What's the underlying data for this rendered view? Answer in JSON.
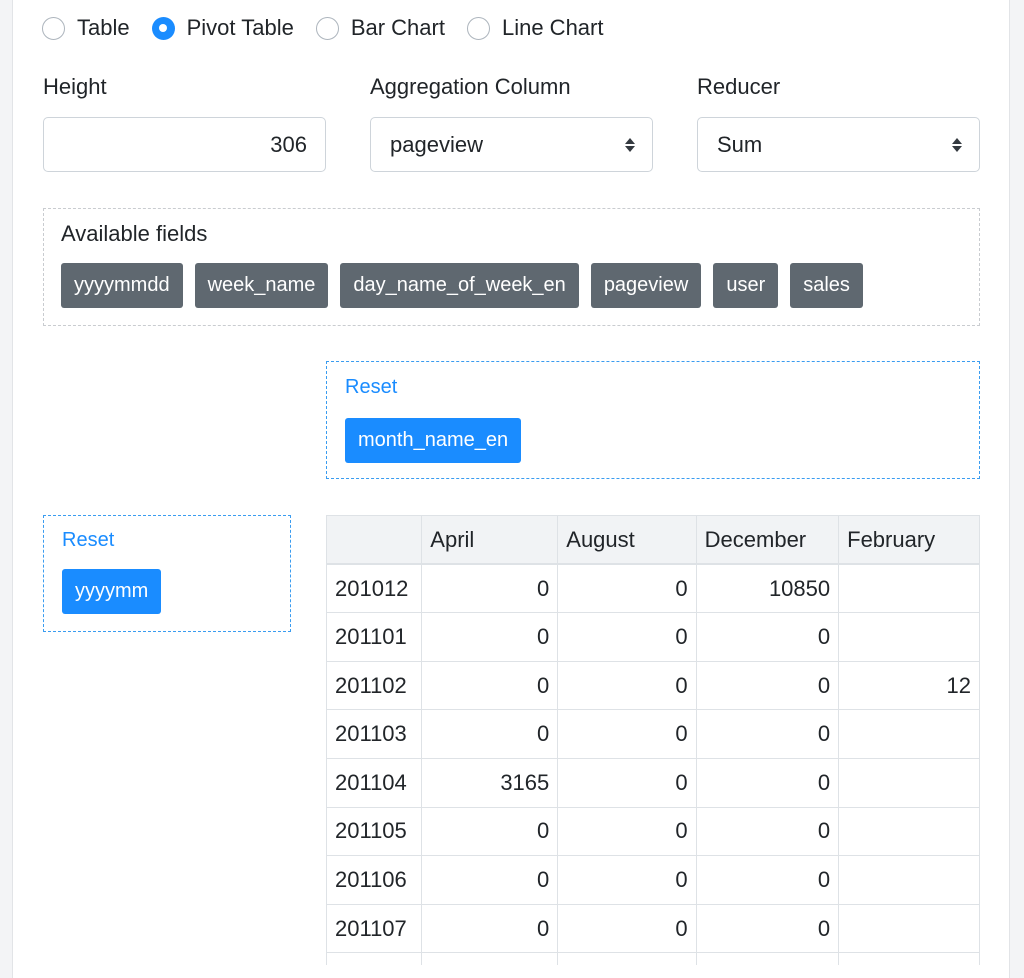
{
  "view_modes": [
    {
      "label": "Table",
      "checked": false
    },
    {
      "label": "Pivot Table",
      "checked": true
    },
    {
      "label": "Bar Chart",
      "checked": false
    },
    {
      "label": "Line Chart",
      "checked": false
    }
  ],
  "height": {
    "label": "Height",
    "value": "306"
  },
  "aggregation": {
    "label": "Aggregation Column",
    "value": "pageview"
  },
  "reducer": {
    "label": "Reducer",
    "value": "Sum"
  },
  "available_fields": {
    "title": "Available fields",
    "chips": [
      "yyyymmdd",
      "week_name",
      "day_name_of_week_en",
      "pageview",
      "user",
      "sales"
    ]
  },
  "column_drop": {
    "reset_label": "Reset",
    "chip": "month_name_en"
  },
  "row_drop": {
    "reset_label": "Reset",
    "chip": "yyyymm"
  },
  "pivot": {
    "columns": [
      "",
      "April",
      "August",
      "December",
      "February"
    ],
    "rows": [
      {
        "key": "201012",
        "values": [
          "0",
          "0",
          "10850",
          ""
        ]
      },
      {
        "key": "201101",
        "values": [
          "0",
          "0",
          "0",
          ""
        ]
      },
      {
        "key": "201102",
        "values": [
          "0",
          "0",
          "0",
          "12"
        ]
      },
      {
        "key": "201103",
        "values": [
          "0",
          "0",
          "0",
          ""
        ]
      },
      {
        "key": "201104",
        "values": [
          "3165",
          "0",
          "0",
          ""
        ]
      },
      {
        "key": "201105",
        "values": [
          "0",
          "0",
          "0",
          ""
        ]
      },
      {
        "key": "201106",
        "values": [
          "0",
          "0",
          "0",
          ""
        ]
      },
      {
        "key": "201107",
        "values": [
          "0",
          "0",
          "0",
          ""
        ]
      },
      {
        "key": "",
        "values": [
          "",
          "",
          "",
          ""
        ]
      }
    ]
  },
  "colors": {
    "accent": "#1a8cff",
    "chip_gray": "#5f6870"
  }
}
